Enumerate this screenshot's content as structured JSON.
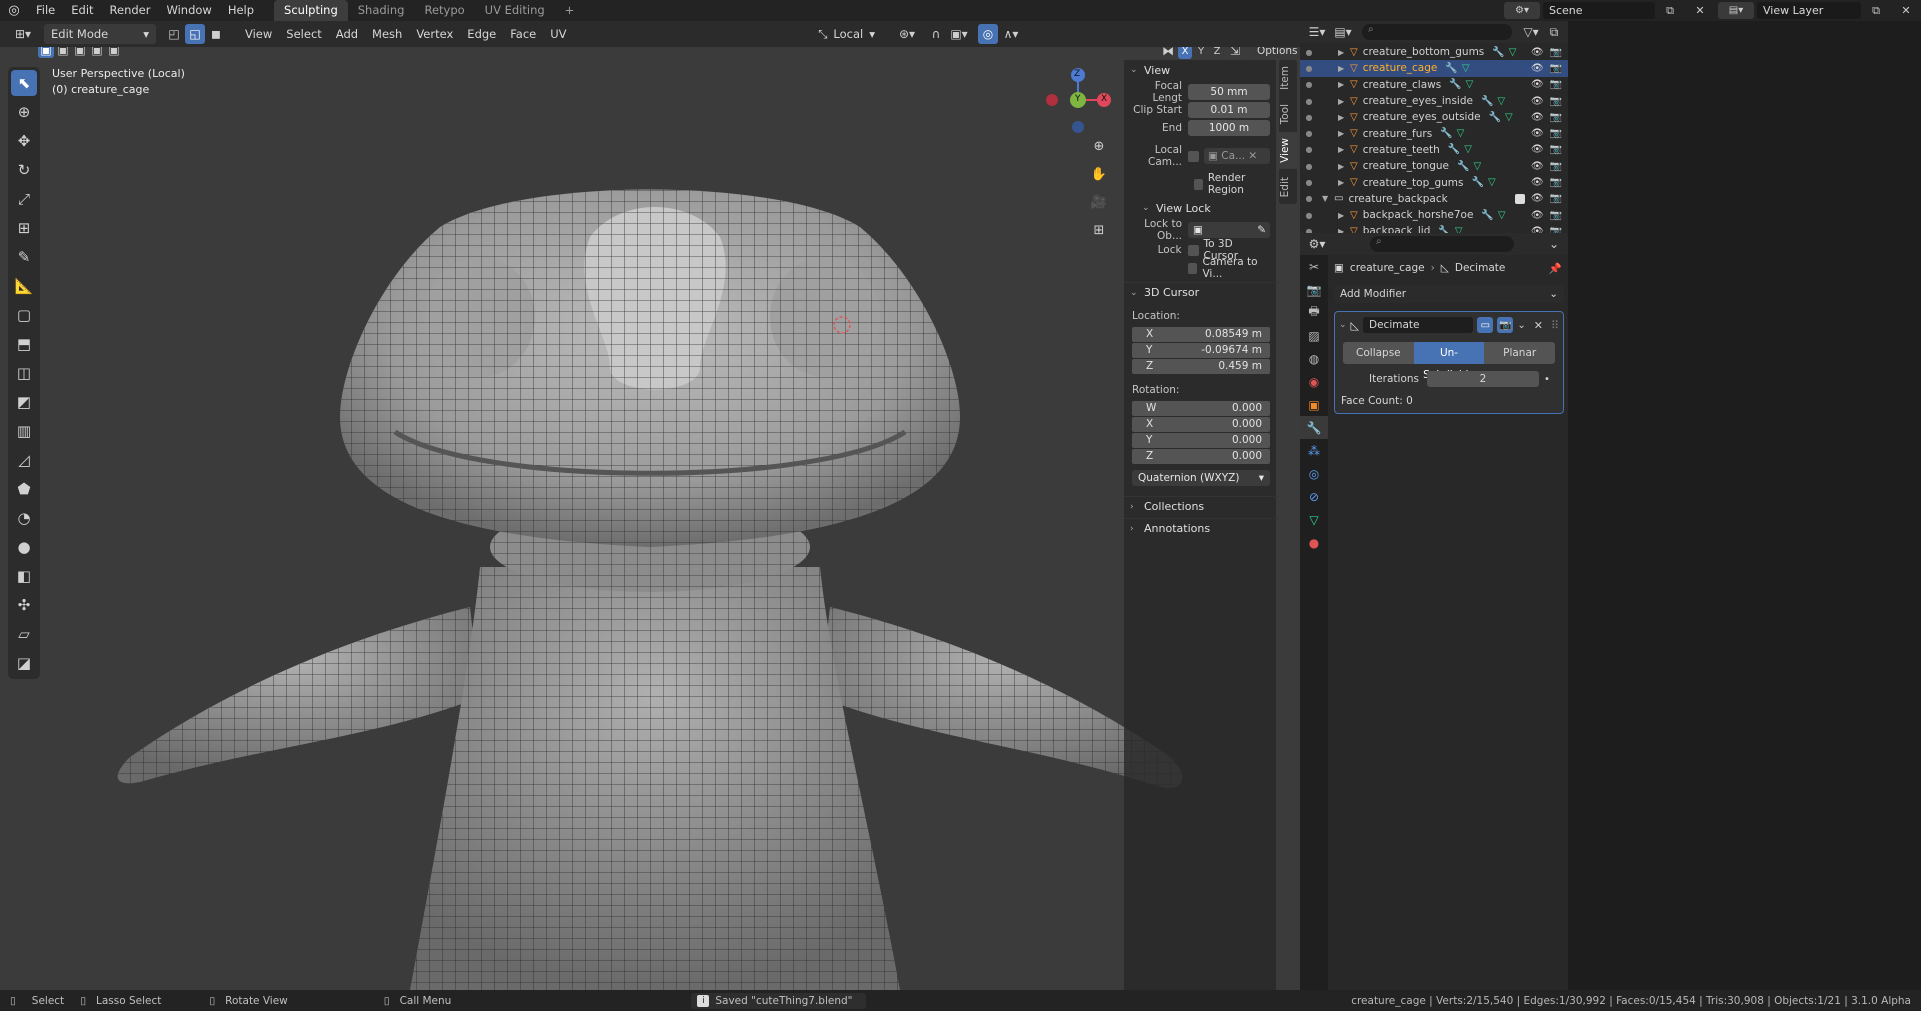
{
  "topbar": {
    "menus": [
      "File",
      "Edit",
      "Render",
      "Window",
      "Help"
    ],
    "workspaces": [
      "Sculpting",
      "Shading",
      "Retypo",
      "UV Editing"
    ],
    "active_workspace": "Sculpting",
    "add_workspace": "+",
    "scene": "Scene",
    "view_layer": "View Layer"
  },
  "viewport_header": {
    "mode": "Edit Mode",
    "menus": [
      "View",
      "Select",
      "Add",
      "Mesh",
      "Vertex",
      "Edge",
      "Face",
      "UV"
    ],
    "transform_orientation": "Local",
    "options": "Options",
    "axis_x": "X",
    "axis_y": "Y",
    "axis_z": "Z"
  },
  "viewport": {
    "perspective": "User Perspective (Local)",
    "object": "(0) creature_cage",
    "gizmo": {
      "x": "X",
      "y": "Y",
      "z": "Z"
    }
  },
  "npanel": {
    "tabs": [
      "Item",
      "Tool",
      "View",
      "Edit"
    ],
    "view_title": "View",
    "focal_label": "Focal Lengt",
    "focal_value": "50 mm",
    "clip_start_label": "Clip Start",
    "clip_start_value": "0.01 m",
    "clip_end_label": "End",
    "clip_end_value": "1000 m",
    "local_cam_label": "Local Cam...",
    "local_cam_value": "Ca...",
    "render_region": "Render Region",
    "view_lock_title": "View Lock",
    "lock_to_ob_label": "Lock to Ob...",
    "lock_label": "Lock",
    "to_3d_cursor": "To 3D Cursor",
    "camera_to_view": "Camera to Vi...",
    "cursor_title": "3D Cursor",
    "location_label": "Location:",
    "location": [
      {
        "axis": "X",
        "value": "0.08549 m"
      },
      {
        "axis": "Y",
        "value": "-0.09674 m"
      },
      {
        "axis": "Z",
        "value": "0.459 m"
      }
    ],
    "rotation_label": "Rotation:",
    "rotation": [
      {
        "axis": "W",
        "value": "0.000"
      },
      {
        "axis": "X",
        "value": "0.000"
      },
      {
        "axis": "Y",
        "value": "0.000"
      },
      {
        "axis": "Z",
        "value": "0.000"
      }
    ],
    "rotation_mode": "Quaternion (WXYZ)",
    "collections": "Collections",
    "annotations": "Annotations"
  },
  "outliner": {
    "rows": [
      {
        "name": "creature_bottom_gums",
        "selected": false
      },
      {
        "name": "creature_cage",
        "selected": true
      },
      {
        "name": "creature_claws",
        "selected": false
      },
      {
        "name": "creature_eyes_inside",
        "selected": false
      },
      {
        "name": "creature_eyes_outside",
        "selected": false
      },
      {
        "name": "creature_furs",
        "selected": false
      },
      {
        "name": "creature_teeth",
        "selected": false
      },
      {
        "name": "creature_tongue",
        "selected": false
      },
      {
        "name": "creature_top_gums",
        "selected": false
      }
    ],
    "collection": "creature_backpack",
    "collection_children": [
      "backpack_horshe7oe",
      "backpack_lid"
    ]
  },
  "properties": {
    "breadcrumb_object": "creature_cage",
    "breadcrumb_modifier": "Decimate",
    "add_modifier": "Add Modifier",
    "modifier_name": "Decimate",
    "modes": [
      "Collapse",
      "Un-Subdivide",
      "Planar"
    ],
    "active_mode": "Un-Subdivide",
    "iterations_label": "Iterations",
    "iterations_value": "2",
    "face_count": "Face Count: 0"
  },
  "statusbar": {
    "select": "Select",
    "lasso": "Lasso Select",
    "rotate": "Rotate View",
    "call_menu": "Call Menu",
    "saved": "Saved \"cuteThing7.blend\"",
    "stats": "creature_cage | Verts:2/15,540 | Edges:1/30,992 | Faces:0/15,454 | Tris:30,908 | Objects:1/21 | 3.1.0 Alpha"
  },
  "colors": {
    "accent": "#4772b3",
    "selected_text": "#ffaf29",
    "mesh_orange": "#ff9b3b"
  }
}
